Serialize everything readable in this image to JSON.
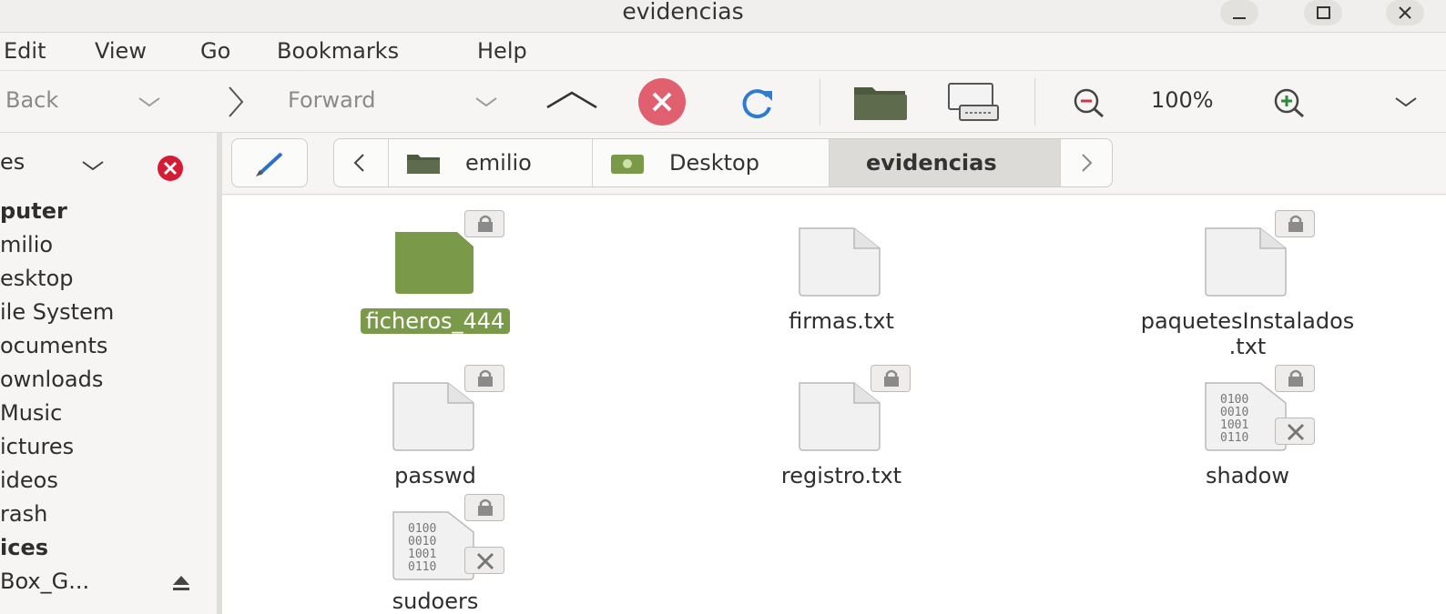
{
  "window": {
    "title": "evidencias",
    "minimize_glyph": "–",
    "maximize_glyph": "☐",
    "close_glyph": "✕"
  },
  "menubar": {
    "items": [
      "Edit",
      "View",
      "Go",
      "Bookmarks",
      "Help"
    ]
  },
  "toolbar": {
    "back_label": "Back",
    "forward_label": "Forward",
    "zoom_level": "100%"
  },
  "sidebar": {
    "header_label": "es",
    "items": [
      {
        "label": "puter",
        "heading": true
      },
      {
        "label": "milio"
      },
      {
        "label": "esktop"
      },
      {
        "label": "ile System"
      },
      {
        "label": "ocuments"
      },
      {
        "label": "ownloads"
      },
      {
        "label": "Music"
      },
      {
        "label": "ictures"
      },
      {
        "label": "ideos"
      },
      {
        "label": "rash"
      },
      {
        "label": "ices",
        "heading": true
      },
      {
        "label": "Box_G..."
      }
    ]
  },
  "breadcrumbs": [
    {
      "label": "emilio",
      "icon": "home-folder-icon"
    },
    {
      "label": "Desktop",
      "icon": "desktop-icon"
    },
    {
      "label": "evidencias",
      "active": true
    }
  ],
  "files": [
    {
      "name": "ficheros_444",
      "type": "folder",
      "selected": true,
      "locked": true
    },
    {
      "name": "firmas.txt",
      "type": "text"
    },
    {
      "name": "paquetesInstalados\n.txt",
      "name_line1": "paquetesInstalados",
      "name_line2": ".txt",
      "type": "text",
      "locked": true
    },
    {
      "name": "passwd",
      "type": "text",
      "locked": true
    },
    {
      "name": "registro.txt",
      "type": "text",
      "locked": true
    },
    {
      "name": "shadow",
      "type": "binary",
      "locked": true,
      "unreadable": true
    },
    {
      "name": "sudoers",
      "type": "binary",
      "locked": true,
      "unreadable": true
    }
  ],
  "binary_glyph_lines": [
    "0100",
    "0010",
    "1001",
    "0110"
  ],
  "colors": {
    "accent_green": "#7a9a4a",
    "stop_red": "#e06070",
    "reload_blue": "#2f7bd1",
    "clear_red": "#d61b35"
  }
}
